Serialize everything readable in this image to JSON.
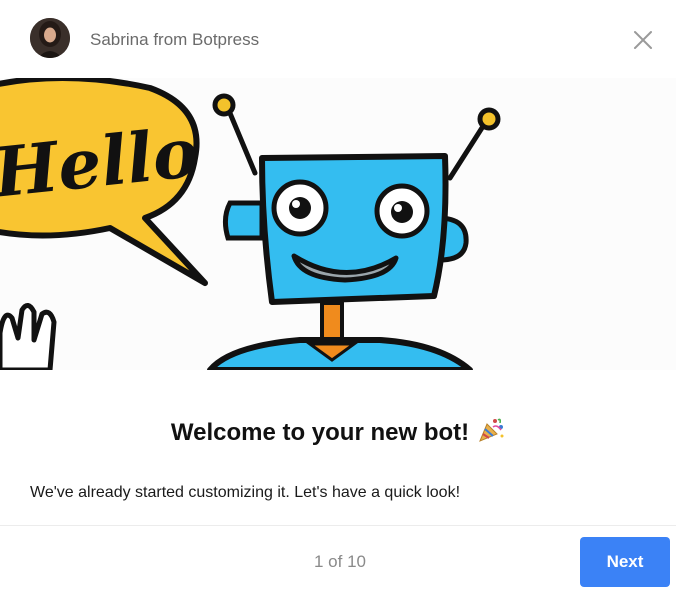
{
  "header": {
    "sender": "Sabrina from Botpress",
    "avatar_icon": "avatar-photo",
    "close_icon": "close-icon"
  },
  "hero": {
    "speech_bubble_text": "Hello",
    "colors": {
      "bubble": "#f9c531",
      "robot": "#34bdf0",
      "neck": "#f08b1d",
      "antenna_tip": "#f3c22b"
    }
  },
  "content": {
    "title": "Welcome to your new bot!",
    "title_icon": "party-popper-icon",
    "body": "We've already started customizing it. Let's have a quick look!"
  },
  "footer": {
    "pager": "1 of 10",
    "next_label": "Next",
    "accent": "#3b82f6"
  }
}
